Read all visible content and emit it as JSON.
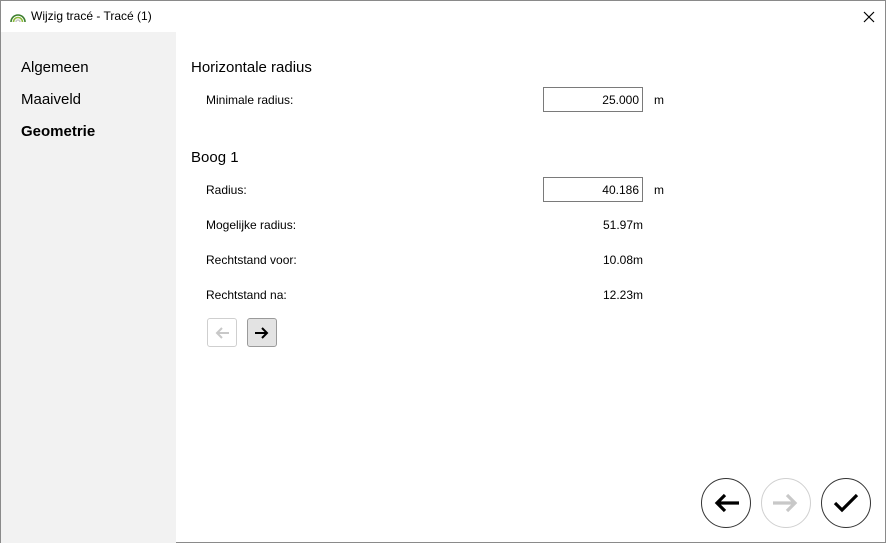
{
  "window": {
    "title": "Wijzig tracé - Tracé (1)"
  },
  "sidebar": {
    "items": [
      {
        "label": "Algemeen",
        "active": false
      },
      {
        "label": "Maaiveld",
        "active": false
      },
      {
        "label": "Geometrie",
        "active": true
      }
    ]
  },
  "horizontal": {
    "title": "Horizontale radius",
    "min_radius_label": "Minimale radius:",
    "min_radius_value": "25.000",
    "unit": "m"
  },
  "arc": {
    "title": "Boog 1",
    "radius_label": "Radius:",
    "radius_value": "40.186",
    "radius_unit": "m",
    "possible_radius_label": "Mogelijke radius:",
    "possible_radius_value": "51.97m",
    "straight_before_label": "Rechtstand voor:",
    "straight_before_value": "10.08m",
    "straight_after_label": "Rechtstand na:",
    "straight_after_value": "12.23m"
  },
  "colors": {
    "sidebar_bg": "#f2f2f2",
    "disabled": "#c8c8c8",
    "enabled_btn_bg": "#e3e3e3"
  },
  "icons": {
    "app": "rainbow-arc-icon",
    "close": "close-icon",
    "prev_arc": "arrow-left-icon",
    "next_arc": "arrow-right-icon",
    "back": "arrow-left-icon",
    "forward": "arrow-right-icon",
    "confirm": "check-icon"
  }
}
